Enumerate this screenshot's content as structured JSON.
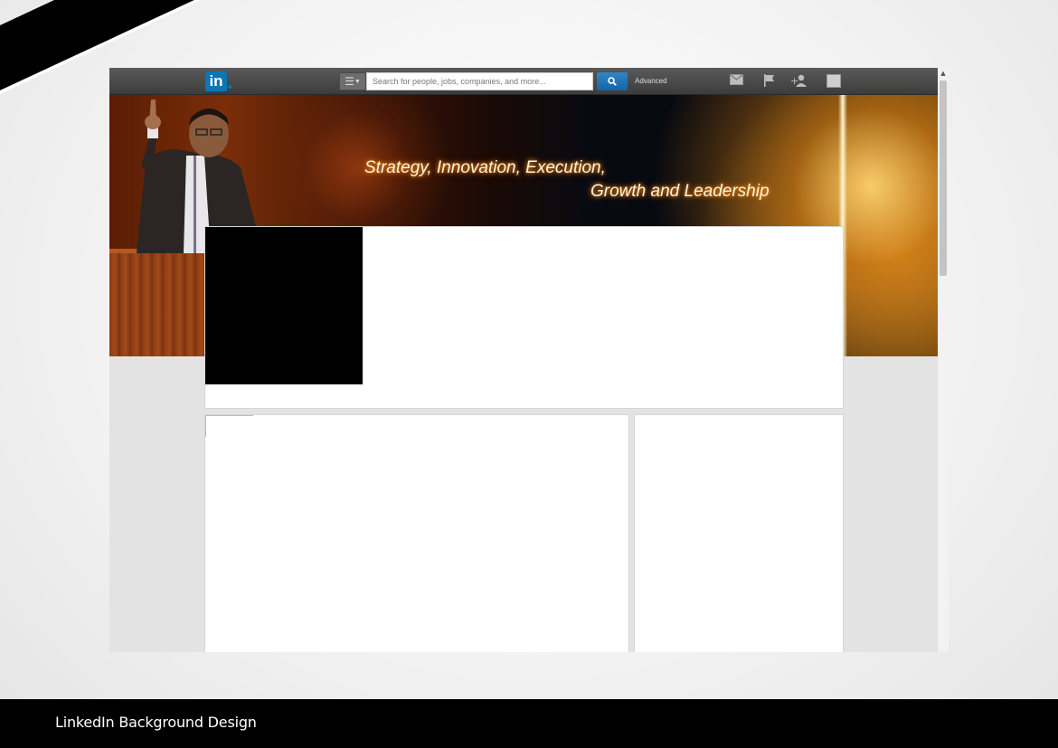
{
  "topbar": {
    "logo_text": "in",
    "search_placeholder": "Search for people, jobs, companies, and more...",
    "advanced_label": "Advanced",
    "icons": [
      "menu-icon",
      "search-icon",
      "mail-icon",
      "flag-icon",
      "add-connection-icon",
      "avatar-icon"
    ]
  },
  "banner": {
    "line1": "Strategy, Innovation, Execution,",
    "line2": "Growth and Leadership"
  },
  "footer": {
    "caption": "LinkedIn Background Design"
  },
  "colors": {
    "brand": "#0a77b5",
    "topbar": "#4a4a4a",
    "banner_text_glow": "#ff9a20",
    "footer_bg": "#000000"
  }
}
